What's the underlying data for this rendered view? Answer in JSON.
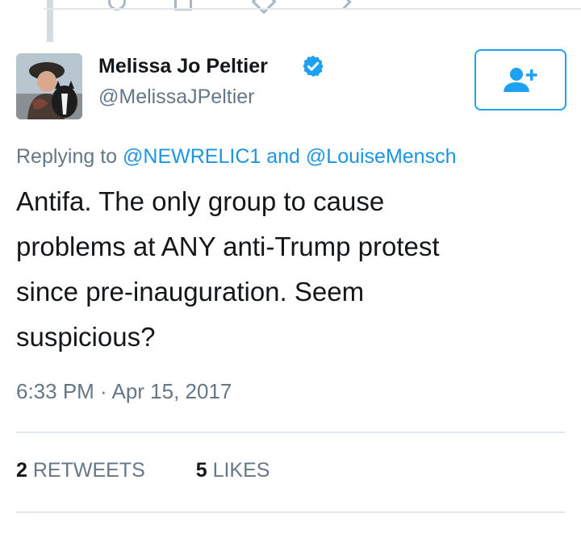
{
  "tweet": {
    "author": {
      "display_name": "Melissa Jo Peltier",
      "handle": "@MelissaJPeltier",
      "verified_icon": "verified-badge-icon",
      "avatar_icon": "profile-photo"
    },
    "follow_button_icon": "add-user-icon",
    "reply_context": {
      "prefix": "Replying to",
      "mention_1": "@NEWRELIC1",
      "connector": "and",
      "mention_2": "@LouiseMensch"
    },
    "text": "Antifa.  The only group to cause\nproblems at ANY anti-Trump protest\nsince pre-inauguration.  Seem\nsuspicious?",
    "timestamp": "6:33 PM · Apr 15, 2017",
    "stats": {
      "retweets_count": "2",
      "retweets_label": "RETWEETS",
      "likes_count": "5",
      "likes_label": "LIKES"
    }
  },
  "colors": {
    "accent": "#1da1f2",
    "mention": "#1b95e0",
    "secondary_text": "#657786",
    "divider": "#e1e8ed"
  }
}
